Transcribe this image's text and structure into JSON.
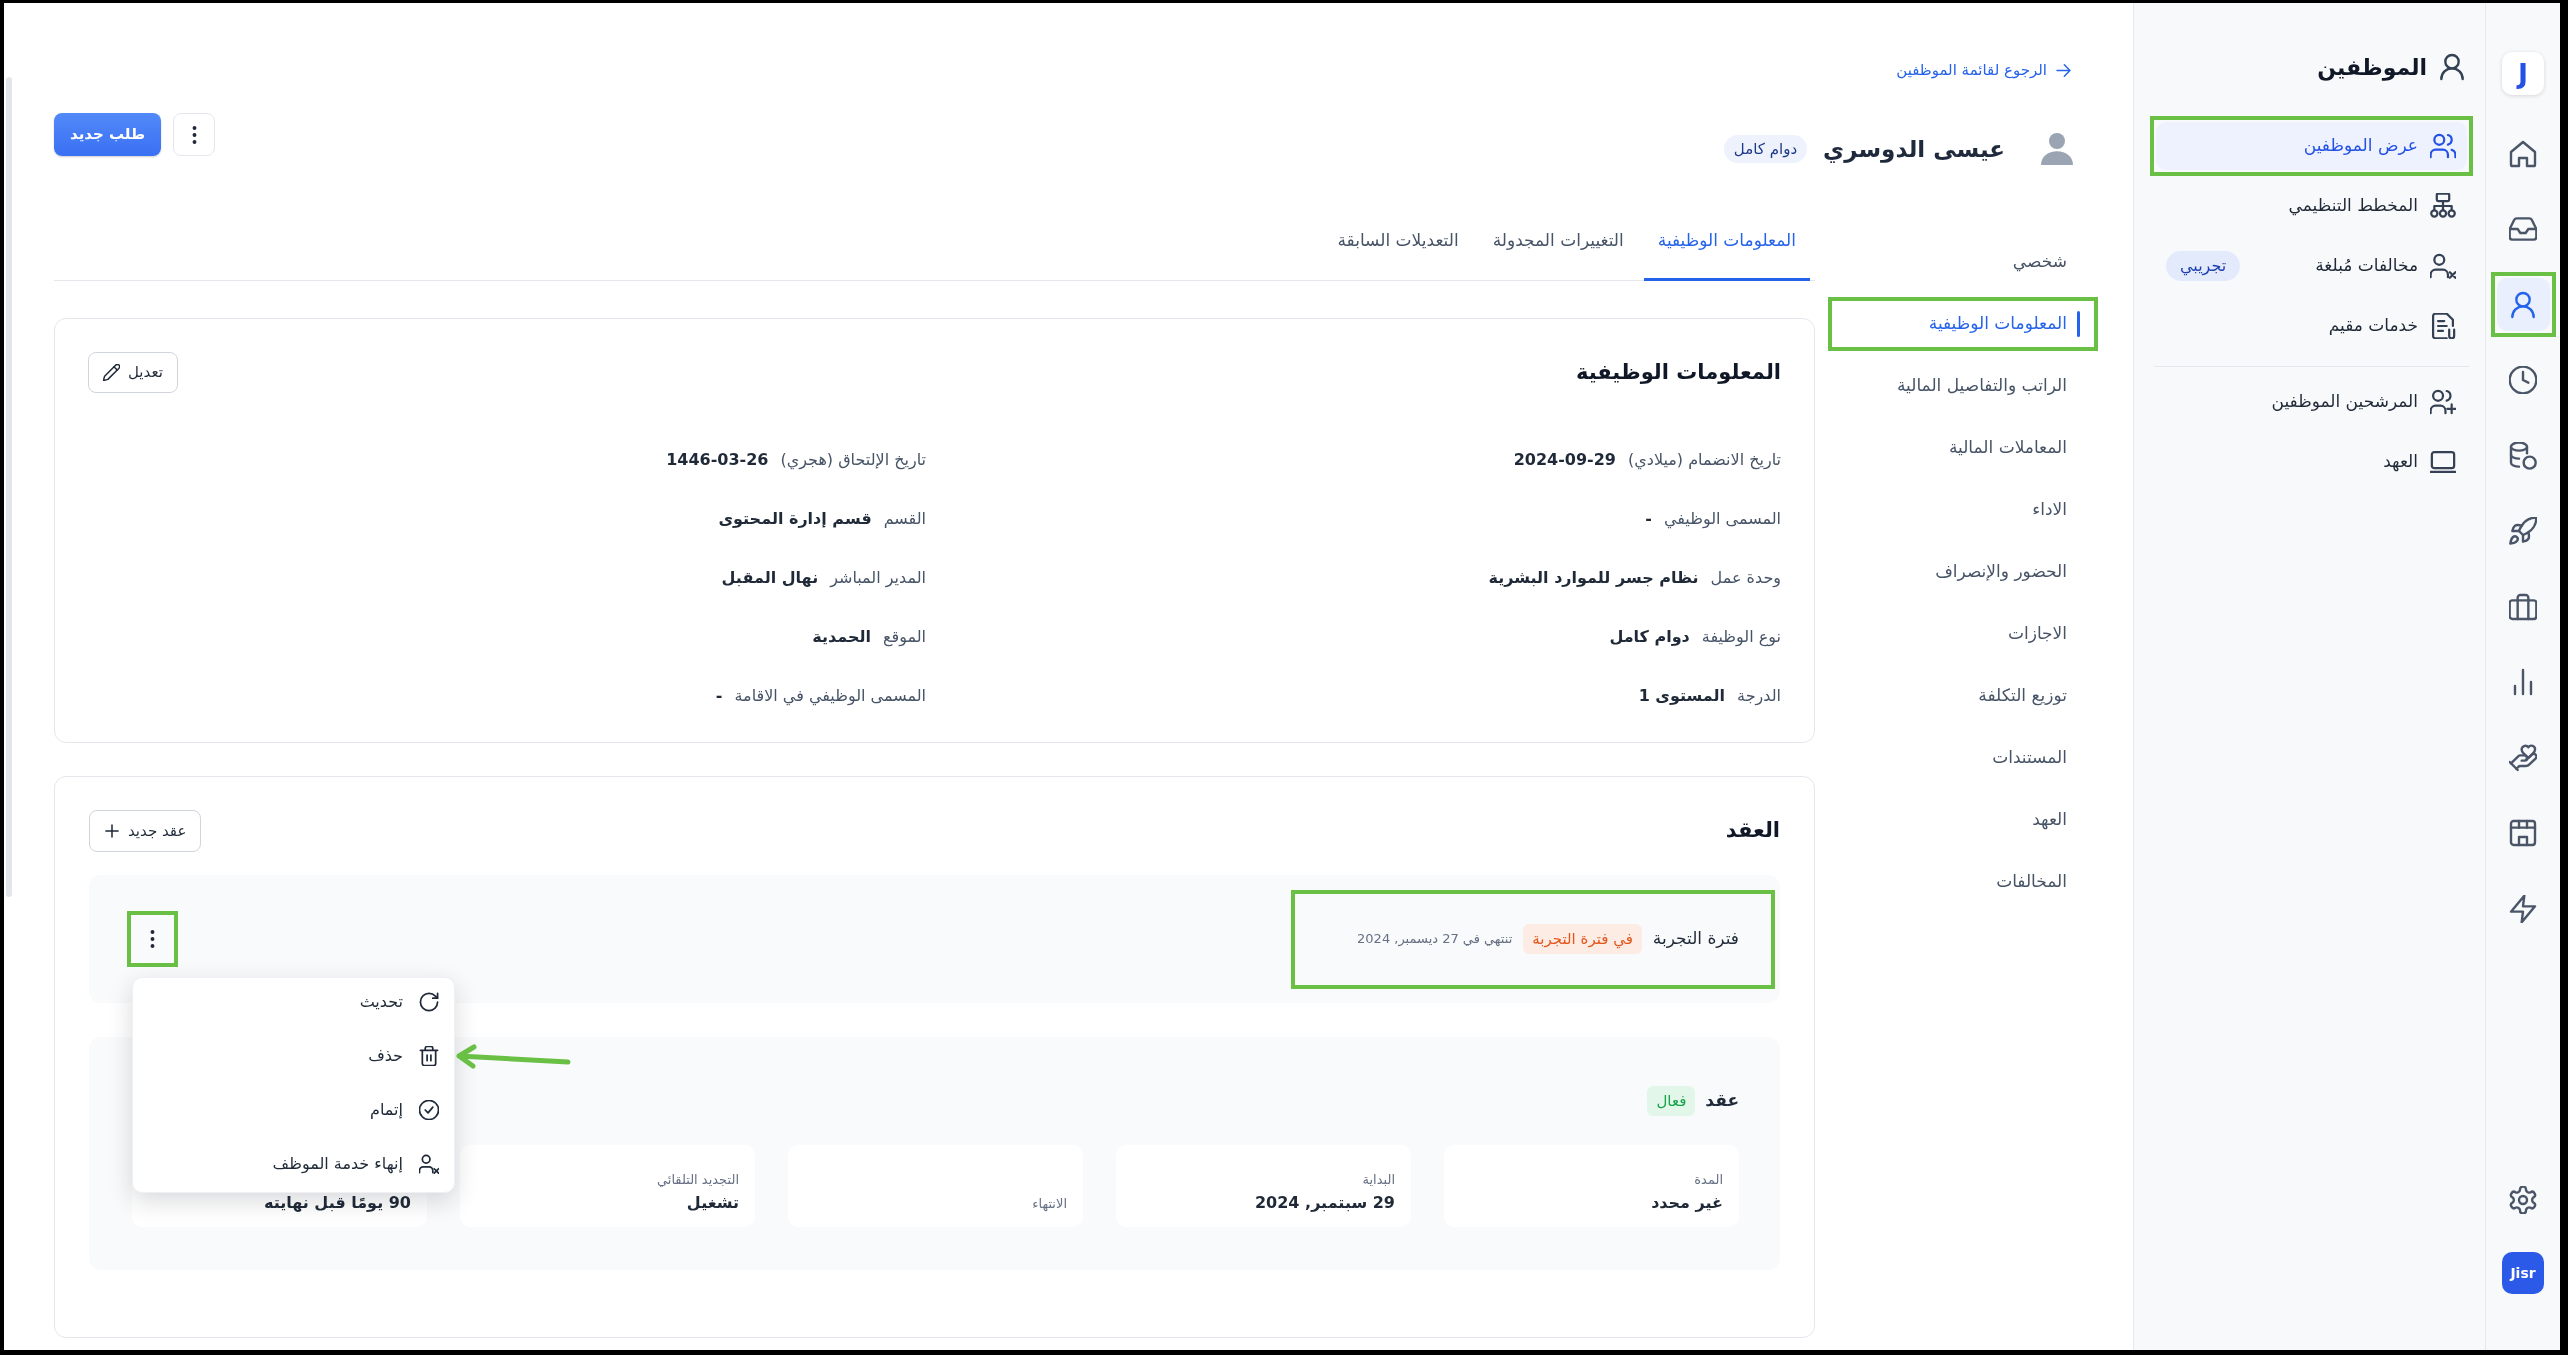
{
  "rail": {
    "logo": "J",
    "items": [
      {
        "selected": false,
        "highlighted": false
      },
      {
        "selected": false,
        "highlighted": false
      },
      {
        "selected": true,
        "highlighted": true
      },
      {
        "selected": false,
        "highlighted": false
      },
      {
        "selected": false,
        "highlighted": false
      },
      {
        "selected": false,
        "highlighted": false
      },
      {
        "selected": false,
        "highlighted": false
      },
      {
        "selected": false,
        "highlighted": false
      },
      {
        "selected": false,
        "highlighted": false
      },
      {
        "selected": false,
        "highlighted": false
      },
      {
        "selected": false,
        "highlighted": false
      }
    ],
    "brand": "Jisr"
  },
  "sidebar": {
    "title": "الموظفين",
    "groups": [
      {
        "items": [
          {
            "label": "عرض الموظفين",
            "selected": true,
            "highlighted": true
          },
          {
            "label": "المخطط التنظيمي",
            "selected": false,
            "highlighted": false
          },
          {
            "label": "مخالفات مُبلغة",
            "selected": false,
            "highlighted": false,
            "badge": "تجريبي"
          },
          {
            "label": "خدمات مقيم",
            "selected": false,
            "highlighted": false
          }
        ]
      },
      {
        "items": [
          {
            "label": "المرشحين الموظفين",
            "selected": false,
            "highlighted": false
          },
          {
            "label": "العهد",
            "selected": false,
            "highlighted": false
          }
        ]
      }
    ]
  },
  "header": {
    "back_link": "الرجوع لقائمة الموظفين",
    "employee_name": "عيسى الدوسري",
    "employment_badge": "دوام كامل",
    "new_request_button": "طلب جديد"
  },
  "section_nav": {
    "items": [
      {
        "label": "شخصي",
        "selected": false,
        "highlighted": false
      },
      {
        "label": "المعلومات الوظيفية",
        "selected": true,
        "highlighted": true
      },
      {
        "label": "الراتب والتفاصيل المالية",
        "selected": false,
        "highlighted": false
      },
      {
        "label": "المعاملات المالية",
        "selected": false,
        "highlighted": false
      },
      {
        "label": "الاداء",
        "selected": false,
        "highlighted": false
      },
      {
        "label": "الحضور والإنصراف",
        "selected": false,
        "highlighted": false
      },
      {
        "label": "الاجازات",
        "selected": false,
        "highlighted": false
      },
      {
        "label": "توزيع التكلفة",
        "selected": false,
        "highlighted": false
      },
      {
        "label": "المستندات",
        "selected": false,
        "highlighted": false
      },
      {
        "label": "العهد",
        "selected": false,
        "highlighted": false
      },
      {
        "label": "المخالفات",
        "selected": false,
        "highlighted": false
      }
    ]
  },
  "tabs": [
    {
      "label": "المعلومات الوظيفية",
      "selected": true
    },
    {
      "label": "التغييرات المجدولة",
      "selected": false
    },
    {
      "label": "التعديلات السابقة",
      "selected": false
    }
  ],
  "job_info": {
    "title": "المعلومات الوظيفية",
    "edit_button": "تعديل",
    "fields": [
      {
        "label": "تاريخ الانضمام (ميلادي)",
        "value": "2024-09-29"
      },
      {
        "label": "تاريخ الإلتحاق (هجري)",
        "value": "1446-03-26"
      },
      {
        "label": "المسمى الوظيفي",
        "value": "-"
      },
      {
        "label": "القسم",
        "value": "قسم إدارة المحتوى"
      },
      {
        "label": "وحدة عمل",
        "value": "نظام جسر للموارد البشرية"
      },
      {
        "label": "المدير المباشر",
        "value": "نهال المقبل"
      },
      {
        "label": "نوع الوظيفة",
        "value": "دوام كامل"
      },
      {
        "label": "الموقع",
        "value": "الحمدية"
      },
      {
        "label": "الدرجة",
        "value": "المستوى 1"
      },
      {
        "label": "المسمى الوظيفي في الاقامة",
        "value": "-"
      }
    ]
  },
  "contract": {
    "title": "العقد",
    "new_contract_button": "عقد جديد",
    "probation": {
      "title": "فترة التجربة",
      "badge": "في فترة التجربة",
      "end_date": "تنتهي في 27 ديسمبر, 2024",
      "highlighted": true,
      "menu_button_highlighted": true,
      "menu": {
        "open": true,
        "items": [
          {
            "label": "تحديث",
            "arrow": false
          },
          {
            "label": "حذف",
            "arrow": true
          },
          {
            "label": "إتمام",
            "arrow": false
          },
          {
            "label": "إنهاء خدمة الموظف",
            "arrow": false
          }
        ]
      }
    },
    "current": {
      "title": "عقد",
      "badge": "فعال",
      "cards": [
        {
          "label": "المدة",
          "value": "غير محدد"
        },
        {
          "label": "البداية",
          "value": "29 سبتمبر, 2024"
        },
        {
          "label": "الانتهاء"
        },
        {
          "label": "التجديد التلقائي",
          "value": "تشغيل"
        },
        {
          "value": "90 يومًا قبل نهايته"
        }
      ]
    }
  }
}
